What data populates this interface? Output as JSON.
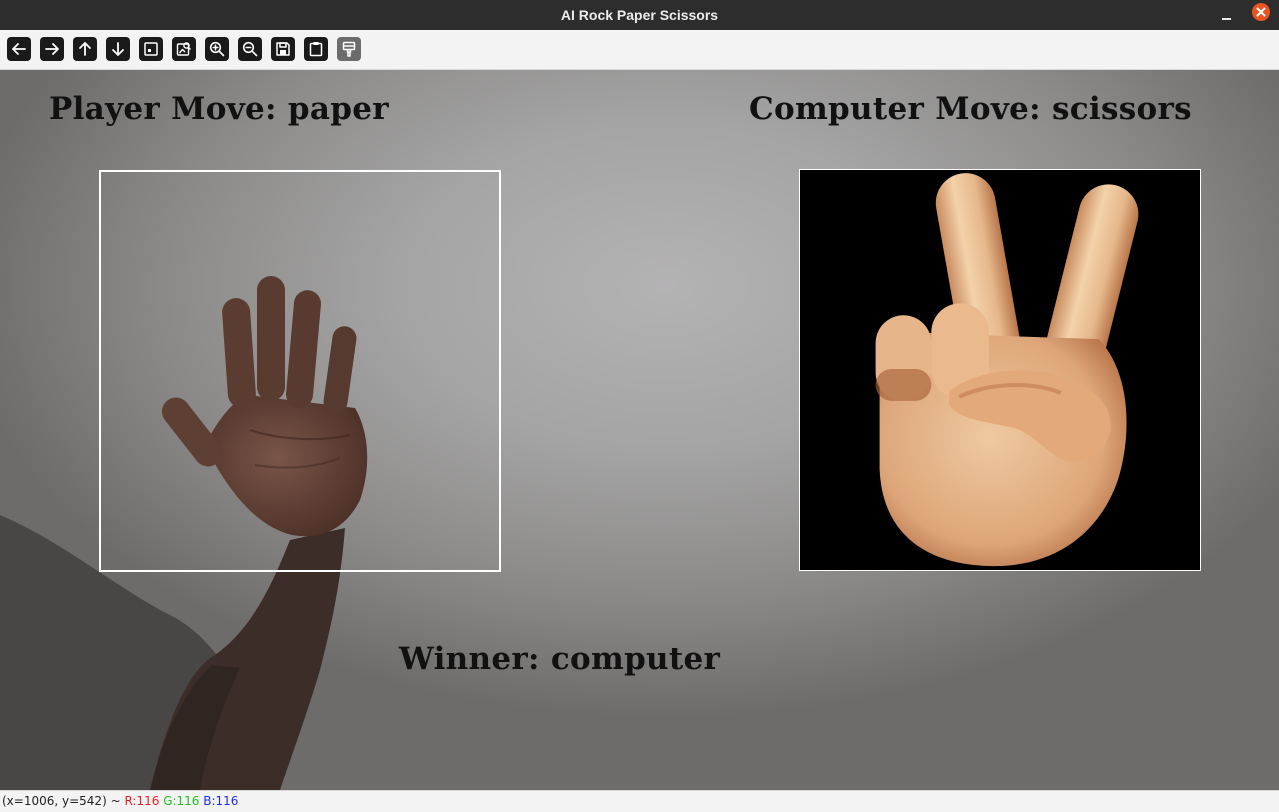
{
  "window": {
    "title": "AI Rock Paper Scissors",
    "minimize_icon": "minimize-icon",
    "close_icon": "close-icon",
    "close_color": "#e95420"
  },
  "toolbar": {
    "buttons": [
      {
        "name": "pan-left-button",
        "icon": "arrow-left-icon"
      },
      {
        "name": "pan-right-button",
        "icon": "arrow-right-icon"
      },
      {
        "name": "pan-up-button",
        "icon": "arrow-up-icon"
      },
      {
        "name": "pan-down-button",
        "icon": "arrow-down-icon"
      },
      {
        "name": "zoom-original-button",
        "icon": "image-fit-icon"
      },
      {
        "name": "zoom-to-fit-button",
        "icon": "image-search-icon"
      },
      {
        "name": "zoom-in-button",
        "icon": "zoom-in-icon"
      },
      {
        "name": "zoom-out-button",
        "icon": "zoom-out-icon"
      },
      {
        "name": "save-button",
        "icon": "save-icon"
      },
      {
        "name": "copy-to-clipboard-button",
        "icon": "clipboard-icon"
      },
      {
        "name": "properties-button",
        "icon": "paint-brush-icon",
        "disabled": true
      }
    ]
  },
  "game": {
    "player_move": "Player Move: paper",
    "computer_move": "Computer Move: scissors",
    "winner": "Winner: computer",
    "player_frame_color": "#ffffff",
    "computer_image_icon": "victory-hand-icon"
  },
  "status": {
    "coords": "(x=1006, y=542) ~ ",
    "r": "R:116",
    "g": "G:116",
    "b": "B:116"
  }
}
